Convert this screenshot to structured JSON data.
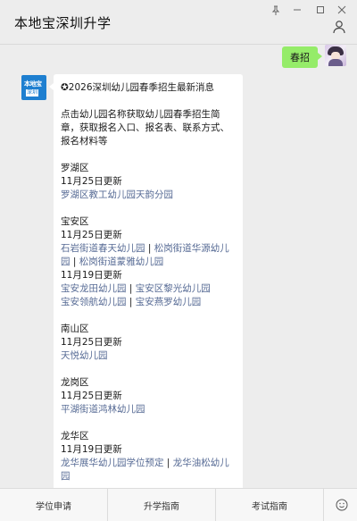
{
  "window": {
    "title": "本地宝深圳升学",
    "controls": [
      "pin-icon",
      "minimize-icon",
      "maximize-icon",
      "close-icon"
    ]
  },
  "chat": {
    "sent_message": "春招",
    "bot_avatar_text": {
      "top": "本地宝",
      "bottom": "深圳"
    },
    "reply": {
      "headline": "✪2026深圳幼儿园春季招生最新消息",
      "intro": [
        "点击幼儿园名称获取幼儿园春季招生简",
        "章，获取报名入口、报名表、联系方式、",
        "报名材料等"
      ],
      "districts": [
        {
          "name": "罗湖区",
          "groups": [
            {
              "date": "11月25日更新",
              "lines": [
                [
                  {
                    "t": "罗湖区教工幼儿园天韵分园",
                    "link": true
                  }
                ]
              ]
            }
          ]
        },
        {
          "name": "宝安区",
          "groups": [
            {
              "date": "11月25日更新",
              "lines": [
                [
                  {
                    "t": "石岩街道春天幼儿园",
                    "link": true
                  },
                  {
                    "t": " | ",
                    "link": false
                  },
                  {
                    "t": "松岗街道华源幼儿",
                    "link": true
                  }
                ],
                [
                  {
                    "t": "园",
                    "link": true
                  },
                  {
                    "t": " | ",
                    "link": false
                  },
                  {
                    "t": "松岗街道蒙雅幼儿园",
                    "link": true
                  }
                ]
              ]
            },
            {
              "date": "11月19日更新",
              "lines": [
                [
                  {
                    "t": "宝安龙田幼儿园",
                    "link": true
                  },
                  {
                    "t": " | ",
                    "link": false
                  },
                  {
                    "t": "宝安区黎光幼儿园",
                    "link": true
                  }
                ],
                [
                  {
                    "t": "宝安领航幼儿园",
                    "link": true
                  },
                  {
                    "t": " | ",
                    "link": false
                  },
                  {
                    "t": "宝安燕罗幼儿园",
                    "link": true
                  }
                ]
              ]
            }
          ]
        },
        {
          "name": "南山区",
          "groups": [
            {
              "date": "11月25日更新",
              "lines": [
                [
                  {
                    "t": "天悦幼儿园",
                    "link": true
                  }
                ]
              ]
            }
          ]
        },
        {
          "name": "龙岗区",
          "groups": [
            {
              "date": "11月25日更新",
              "lines": [
                [
                  {
                    "t": "平湖街道鸿林幼儿园",
                    "link": true
                  }
                ]
              ]
            }
          ]
        },
        {
          "name": "龙华区",
          "groups": [
            {
              "date": "11月19日更新",
              "lines": [
                [
                  {
                    "t": "龙华展华幼儿园学位预定",
                    "link": true
                  },
                  {
                    "t": " | ",
                    "link": false
                  },
                  {
                    "t": "龙华油松幼儿",
                    "link": true
                  }
                ],
                [
                  {
                    "t": "园",
                    "link": true
                  }
                ]
              ]
            }
          ]
        }
      ]
    }
  },
  "bottom_menu": {
    "items": [
      "学位申请",
      "升学指南",
      "考试指南"
    ],
    "keyboard_icon": "keyboard-icon"
  },
  "colors": {
    "background": "#ededed",
    "sent_bubble": "#95ec69",
    "link": "#576b95"
  }
}
